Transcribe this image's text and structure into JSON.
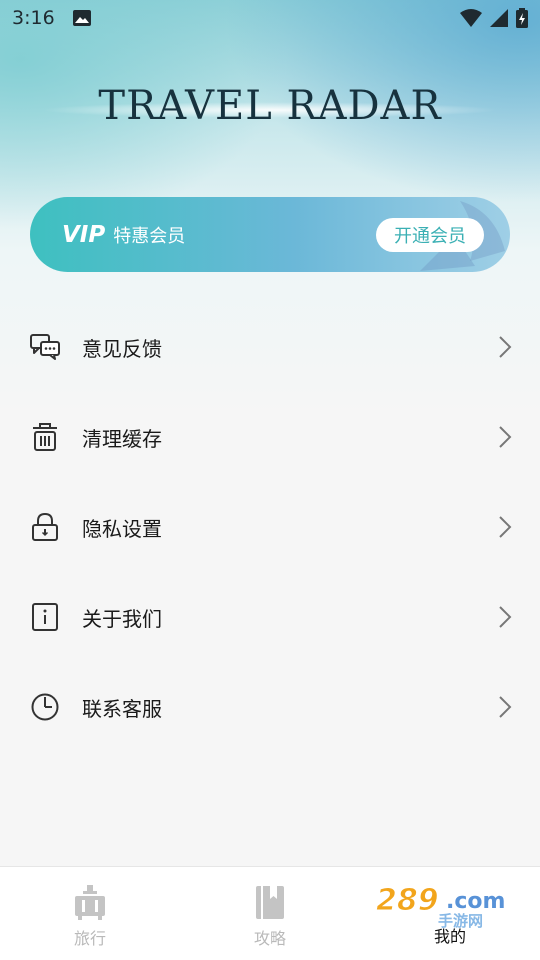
{
  "status_bar": {
    "time": "3:16",
    "photo_icon": "image-icon",
    "wifi_icon": "wifi-icon",
    "signal_icon": "cell-signal-icon",
    "battery_icon": "battery-icon"
  },
  "header": {
    "title": "TRAVEL RADAR"
  },
  "vip_card": {
    "logo": "VIP",
    "text": "特惠会员",
    "button_label": "开通会员",
    "accent": "#3ec0c0"
  },
  "menu": {
    "items": [
      {
        "label": "意见反馈",
        "icon": "chat-bubbles-icon"
      },
      {
        "label": "清理缓存",
        "icon": "trash-icon"
      },
      {
        "label": "隐私设置",
        "icon": "lock-icon"
      },
      {
        "label": "关于我们",
        "icon": "info-icon"
      },
      {
        "label": "联系客服",
        "icon": "clock-icon"
      }
    ]
  },
  "tabbar": {
    "tabs": [
      {
        "label": "旅行",
        "icon": "luggage-icon",
        "active": false
      },
      {
        "label": "攻略",
        "icon": "book-icon",
        "active": false
      },
      {
        "label": "我的",
        "icon": "profile-icon",
        "active": true
      }
    ]
  },
  "watermark": {
    "text": "289.com",
    "subtext": "手游网"
  }
}
